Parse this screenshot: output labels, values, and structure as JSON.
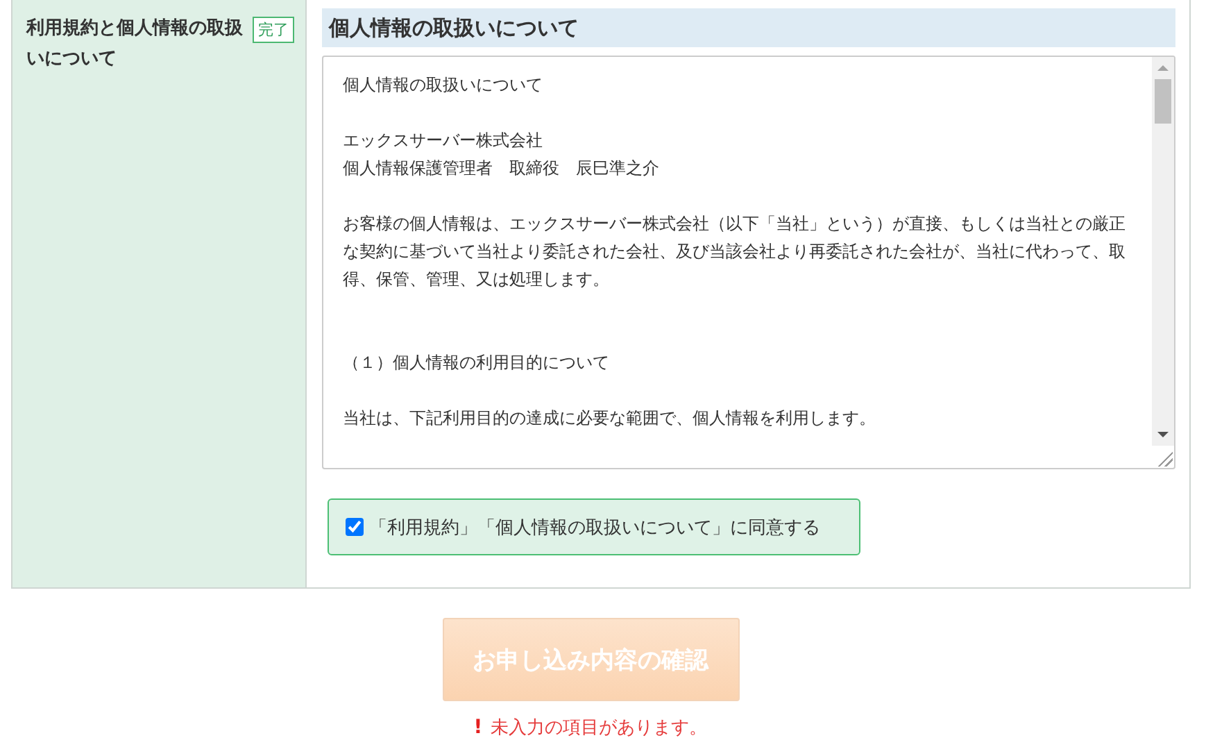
{
  "row": {
    "label": "利用規約と個人情報の取扱いについて",
    "badge": "完了"
  },
  "section": {
    "title": "個人情報の取扱いについて",
    "paragraphs": [
      {
        "lines": [
          "個人情報の取扱いについて"
        ]
      },
      {
        "lines": [
          "エックスサーバー株式会社",
          "個人情報保護管理者　取締役　辰巳準之介"
        ]
      },
      {
        "lines": [
          "お客様の個人情報は、エックスサーバー株式会社（以下「当社」という）が直接、もしくは当社との厳正な契約に基づいて当社より委託された会社、及び当該会社より再委託された会社が、当社に代わって、取得、保管、管理、又は処理します。"
        ]
      },
      {
        "lines": [
          "（１）個人情報の利用目的について"
        ]
      },
      {
        "lines": [
          "当社は、下記利用目的の達成に必要な範囲で、個人情報を利用します。"
        ]
      }
    ],
    "agree": {
      "label": "「利用規約」「個人情報の取扱いについて」に同意する",
      "checked": true
    }
  },
  "submit": {
    "label": "お申し込み内容の確認",
    "disabled": true
  },
  "error": {
    "icon": "!",
    "message": "未入力の項目があります。"
  }
}
